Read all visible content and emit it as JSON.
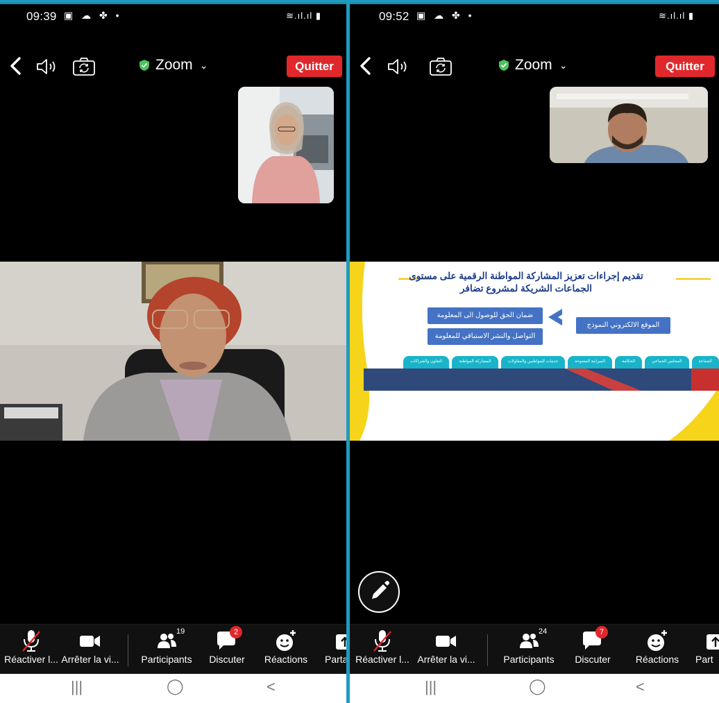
{
  "left": {
    "status": {
      "time": "09:39"
    },
    "topbar": {
      "app": "Zoom",
      "quit": "Quitter"
    },
    "toolbar": {
      "unmute": "Réactiver l...",
      "stop_video": "Arrêter la vi...",
      "participants": "Participants",
      "participants_count": "19",
      "chat": "Discuter",
      "chat_badge": "2",
      "reactions": "Réactions",
      "share": "Parta"
    }
  },
  "right": {
    "status": {
      "time": "09:52"
    },
    "topbar": {
      "app": "Zoom",
      "quit": "Quitter"
    },
    "slide": {
      "title_line1": "تقديم إجراءات تعزيز المشاركة المواطنة الرقمية على مستوى",
      "title_line2": "الجماعات الشريكة لمشروع تضافر",
      "box_right": "الموقع الالكتروني النموذج",
      "box_top": "ضمان الحق للوصول الى المعلومة",
      "box_bottom": "التواصل والنشر الاستباقي للمعلومة",
      "tabs": [
        "الجماعة",
        "المجلس الجماعي",
        "الحكامة",
        "الميزانية المفتوحة",
        "خدمات للمواطنين والمقاولات",
        "المشاركة المواطنة",
        "التعاون والشراكات"
      ]
    },
    "toolbar": {
      "unmute": "Réactiver l...",
      "stop_video": "Arrêter la vi...",
      "participants": "Participants",
      "participants_count": "24",
      "chat": "Discuter",
      "chat_badge": "7",
      "reactions": "Réactions",
      "share": "Part"
    }
  },
  "colors": {
    "quit": "#e0282c",
    "divider": "#1e9cc0",
    "slide_blue": "#4472c4",
    "slide_cyan": "#19b4c9"
  }
}
